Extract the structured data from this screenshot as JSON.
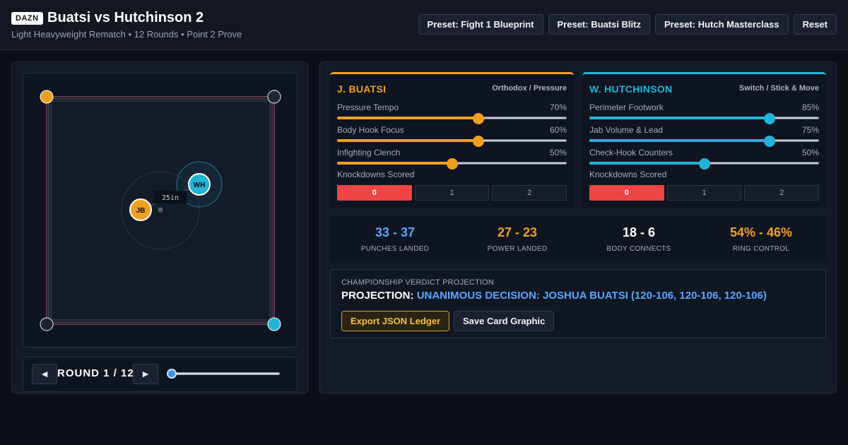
{
  "header": {
    "badge": "DAZN",
    "title": "Buatsi vs Hutchinson 2",
    "subtitle": "Light Heavyweight Rematch • 12 Rounds • Point 2 Prove",
    "presets": [
      "Preset: Fight 1 Blueprint",
      "Preset: Buatsi Blitz",
      "Preset: Hutch Masterclass",
      "Reset"
    ]
  },
  "ring": {
    "corner_colors": {
      "top_left": "#f0a020",
      "top_right": "#1e2430",
      "bottom_left": "#1e2430",
      "bottom_right": "#22b4d8"
    },
    "fighter_a_initials": "JB",
    "fighter_b_initials": "WH",
    "distance_label": "25in"
  },
  "controls": {
    "prev_icon": "◄",
    "next_icon": "►",
    "round_label": "ROUND 1 / 12",
    "round_value": 1,
    "round_max": 12
  },
  "fighters": [
    {
      "name": "J. BUATSI",
      "style": "Orthodox / Pressure",
      "color": "#f0a020",
      "stats": [
        {
          "label": "Pressure Tempo",
          "value_text": "70%",
          "value": 0.62
        },
        {
          "label": "Body Hook Focus",
          "value_text": "60%",
          "value": 0.62
        },
        {
          "label": "Infighting Clench",
          "value_text": "50%",
          "value": 0.5
        }
      ],
      "knockdowns_label": "Knockdowns Scored",
      "knockdowns_options": [
        "0",
        "1",
        "2"
      ],
      "knockdowns_selected": 0
    },
    {
      "name": "W. HUTCHINSON",
      "style": "Switch / Stick & Move",
      "color": "#22b4d8",
      "stats": [
        {
          "label": "Perimeter Footwork",
          "value_text": "85%",
          "value": 0.8
        },
        {
          "label": "Jab Volume & Lead",
          "value_text": "75%",
          "value": 0.8
        },
        {
          "label": "Check-Hook Counters",
          "value_text": "50%",
          "value": 0.5
        }
      ],
      "knockdowns_label": "Knockdowns Scored",
      "knockdowns_options": [
        "0",
        "1",
        "2"
      ],
      "knockdowns_selected": 0
    }
  ],
  "summary": [
    {
      "value": "33 - 37",
      "label": "PUNCHES LANDED",
      "color": "#5aa6ff"
    },
    {
      "value": "27 - 23",
      "label": "POWER LANDED",
      "color": "#f0a020"
    },
    {
      "value": "18 - 6",
      "label": "BODY CONNECTS",
      "color": "#ffffff"
    },
    {
      "value": "54% - 46%",
      "label": "RING CONTROL",
      "color": "#f0a020"
    }
  ],
  "verdict": {
    "heading": "CHAMPIONSHIP VERDICT PROJECTION",
    "prefix": "PROJECTION:",
    "result": "UNANIMOUS DECISION: JOSHUA BUATSI (120-106, 120-106, 120-106)",
    "export_label": "Export JSON Ledger",
    "save_label": "Save Card Graphic"
  }
}
